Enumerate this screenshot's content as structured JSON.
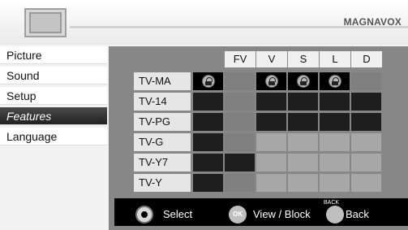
{
  "brand": "MAGNAVOX",
  "sidebar": {
    "items": [
      {
        "label": "Picture"
      },
      {
        "label": "Sound"
      },
      {
        "label": "Setup"
      },
      {
        "label": "Features"
      },
      {
        "label": "Language"
      }
    ]
  },
  "grid": {
    "columns": [
      "FV",
      "V",
      "S",
      "L",
      "D"
    ],
    "rows": [
      {
        "label": "TV-MA",
        "locked_columns": [
          "FV",
          "S",
          "L"
        ]
      },
      {
        "label": "TV-14",
        "locked_columns": []
      },
      {
        "label": "TV-PG",
        "locked_columns": []
      },
      {
        "label": "TV-G",
        "locked_columns": []
      },
      {
        "label": "TV-Y7",
        "locked_columns": []
      },
      {
        "label": "TV-Y",
        "locked_columns": []
      }
    ]
  },
  "footer": {
    "select_label": "Select",
    "ok_icon_label": "OK",
    "view_block_label": "View / Block",
    "back_icon_label": "BACK",
    "back_label": "Back"
  },
  "colors": {
    "accent_selected": "#222222",
    "panel_bg": "#878787",
    "footer_bg": "#000000"
  }
}
